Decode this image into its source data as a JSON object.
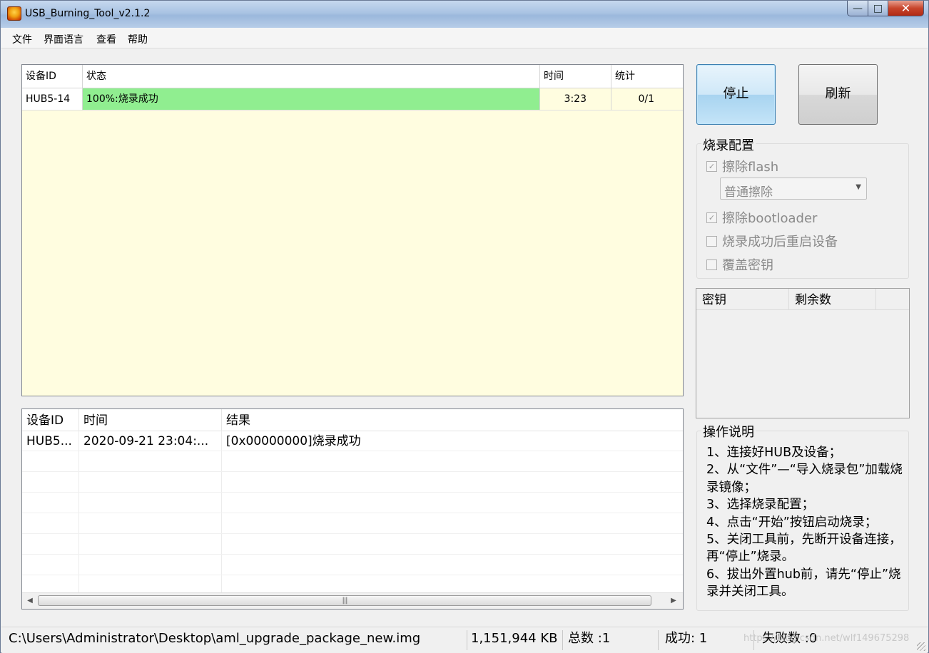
{
  "window": {
    "title": "USB_Burning_Tool_v2.1.2",
    "controls": {
      "minimize": "—",
      "maximize": "□",
      "close": "✕"
    }
  },
  "menu": [
    "文件",
    "界面语言",
    "查看",
    "帮助"
  ],
  "device_table": {
    "headers": [
      "设备ID",
      "状态",
      "时间",
      "统计"
    ],
    "rows": [
      {
        "device_id": "HUB5-14",
        "status": "100%:烧录成功",
        "progress": 1.0,
        "time": "3:23",
        "stats": "0/1"
      }
    ]
  },
  "result_table": {
    "headers": [
      "设备ID",
      "时间",
      "结果"
    ],
    "rows": [
      {
        "device_id": "HUB5...",
        "time": "2020-09-21 23:04:...",
        "result": "[0x00000000]烧录成功"
      }
    ]
  },
  "buttons": {
    "stop": "停止",
    "refresh": "刷新"
  },
  "config": {
    "title": "烧录配置",
    "erase_flash": {
      "label": "擦除flash",
      "checked": true
    },
    "erase_mode": "普通擦除",
    "erase_bootloader": {
      "label": "擦除bootloader",
      "checked": true
    },
    "reboot_after": {
      "label": "烧录成功后重启设备",
      "checked": false
    },
    "overwrite_key": {
      "label": "覆盖密钥",
      "checked": false
    }
  },
  "key_table": {
    "headers": [
      "密钥",
      "剩余数"
    ]
  },
  "help": {
    "title": "操作说明",
    "lines": [
      "1、连接好HUB及设备；",
      "2、从“文件”—“导入烧录包”加载烧录镜像；",
      "3、选择烧录配置；",
      "4、点击“开始”按钮启动烧录；",
      "5、关闭工具前，先断开设备连接，再“停止”烧录。",
      "6、拔出外置hub前，请先“停止”烧录并关闭工具。"
    ]
  },
  "status": {
    "path": "C:\\Users\\Administrator\\Desktop\\aml_upgrade_package_new.img",
    "size": "1,151,944 KB",
    "total": "总数 :1",
    "success": "成功:  1",
    "failed": "失败数 :0"
  },
  "watermark": "https://blog.csdn.net/wlf149675298",
  "colors": {
    "progress_fill": "#90ee90",
    "device_bg": "#fffde0"
  }
}
